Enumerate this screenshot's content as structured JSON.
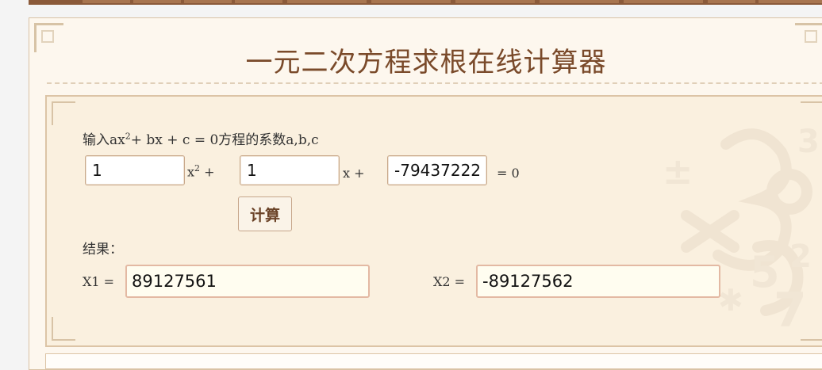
{
  "title": "一元二次方程求根在线计算器",
  "prompt": {
    "prefix": "输入ax",
    "exp": "2",
    "rest": "+ bx + c = 0方程的系数a,b,c"
  },
  "inputs": {
    "a": "1",
    "b": "1",
    "c": "-79437222"
  },
  "suffixes": {
    "a_var": "x",
    "a_exp": "2",
    "a_op": " +",
    "b": "x +",
    "c": "= 0"
  },
  "button": {
    "label": "计算"
  },
  "result": {
    "label": "结果：",
    "x1_label": "X1 =",
    "x1_value": "89127561",
    "x2_label": "X2 =",
    "x2_value": "-89127562"
  },
  "colors": {
    "accent": "#7a4a2a",
    "panel_bg": "#faf0df",
    "result_bg": "#fffdf0"
  }
}
